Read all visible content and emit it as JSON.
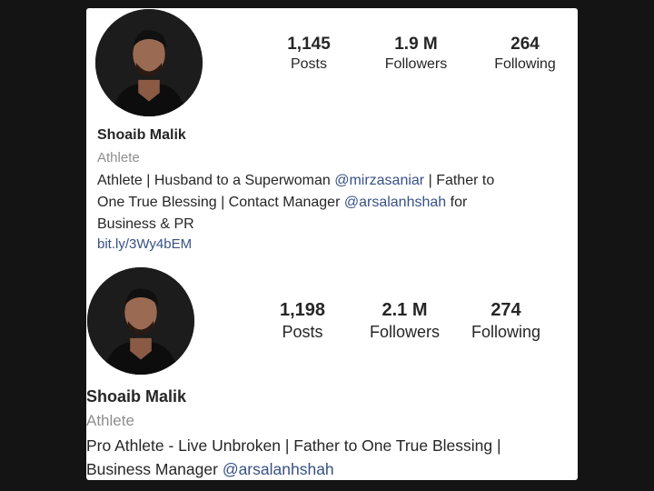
{
  "profiles": [
    {
      "stats": [
        {
          "value": "1,145",
          "label": "Posts"
        },
        {
          "value": "1.9 M",
          "label": "Followers"
        },
        {
          "value": "264",
          "label": "Following"
        }
      ],
      "name": "Shoaib Malik",
      "category": "Athlete",
      "bio": {
        "line1_a": "Athlete | Husband to a Superwoman ",
        "line1_mention": "@mirzasaniar",
        "line1_b": " | Father to",
        "line2_a": "One True Blessing | Contact Manager ",
        "line2_mention": "@arsalanhshah",
        "line2_b": " for",
        "line3": "Business & PR"
      },
      "link": "bit.ly/3Wy4bEM"
    },
    {
      "stats": [
        {
          "value": "1,198",
          "label": "Posts"
        },
        {
          "value": "2.1 M",
          "label": "Followers"
        },
        {
          "value": "274",
          "label": "Following"
        }
      ],
      "name": "Shoaib Malik",
      "category": "Athlete",
      "bio": {
        "line1": "Pro Athlete - Live Unbroken | Father to One True Blessing |",
        "line2_a": "Business Manager ",
        "line2_mention": "@arsalanhshah"
      }
    }
  ]
}
